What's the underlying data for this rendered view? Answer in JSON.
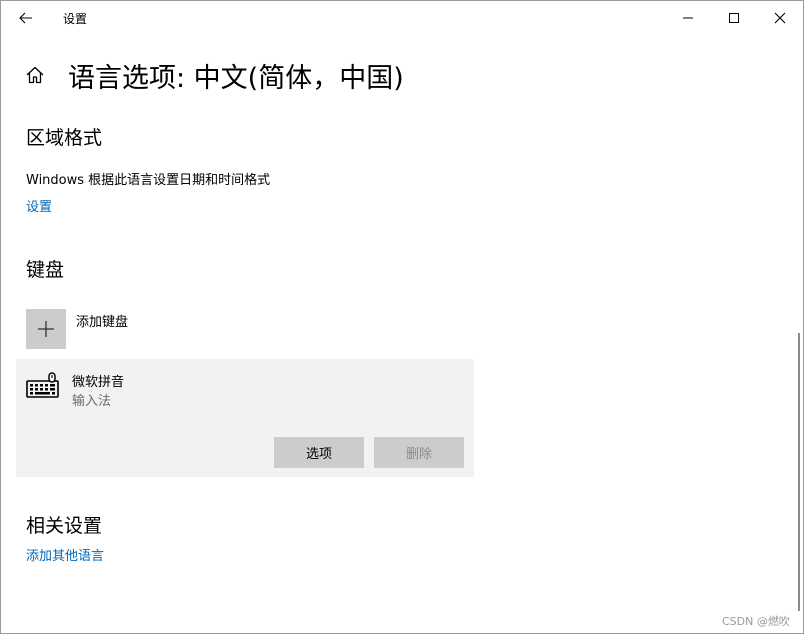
{
  "window": {
    "title": "设置"
  },
  "header": {
    "page_title": "语言选项: 中文(简体，中国)"
  },
  "region_format": {
    "heading": "区域格式",
    "description": "Windows 根据此语言设置日期和时间格式",
    "settings_link": "设置"
  },
  "keyboard": {
    "heading": "键盘",
    "add_label": "添加键盘",
    "items": [
      {
        "name": "微软拼音",
        "type": "输入法",
        "options_label": "选项",
        "remove_label": "删除"
      }
    ]
  },
  "related": {
    "heading": "相关设置",
    "add_language_link": "添加其他语言"
  },
  "watermark": "CSDN @燃吹",
  "colors": {
    "link": "#0067b8",
    "card_bg": "#f2f2f2",
    "button_bg": "#cccccc",
    "disabled_text": "#8a8a8a"
  }
}
